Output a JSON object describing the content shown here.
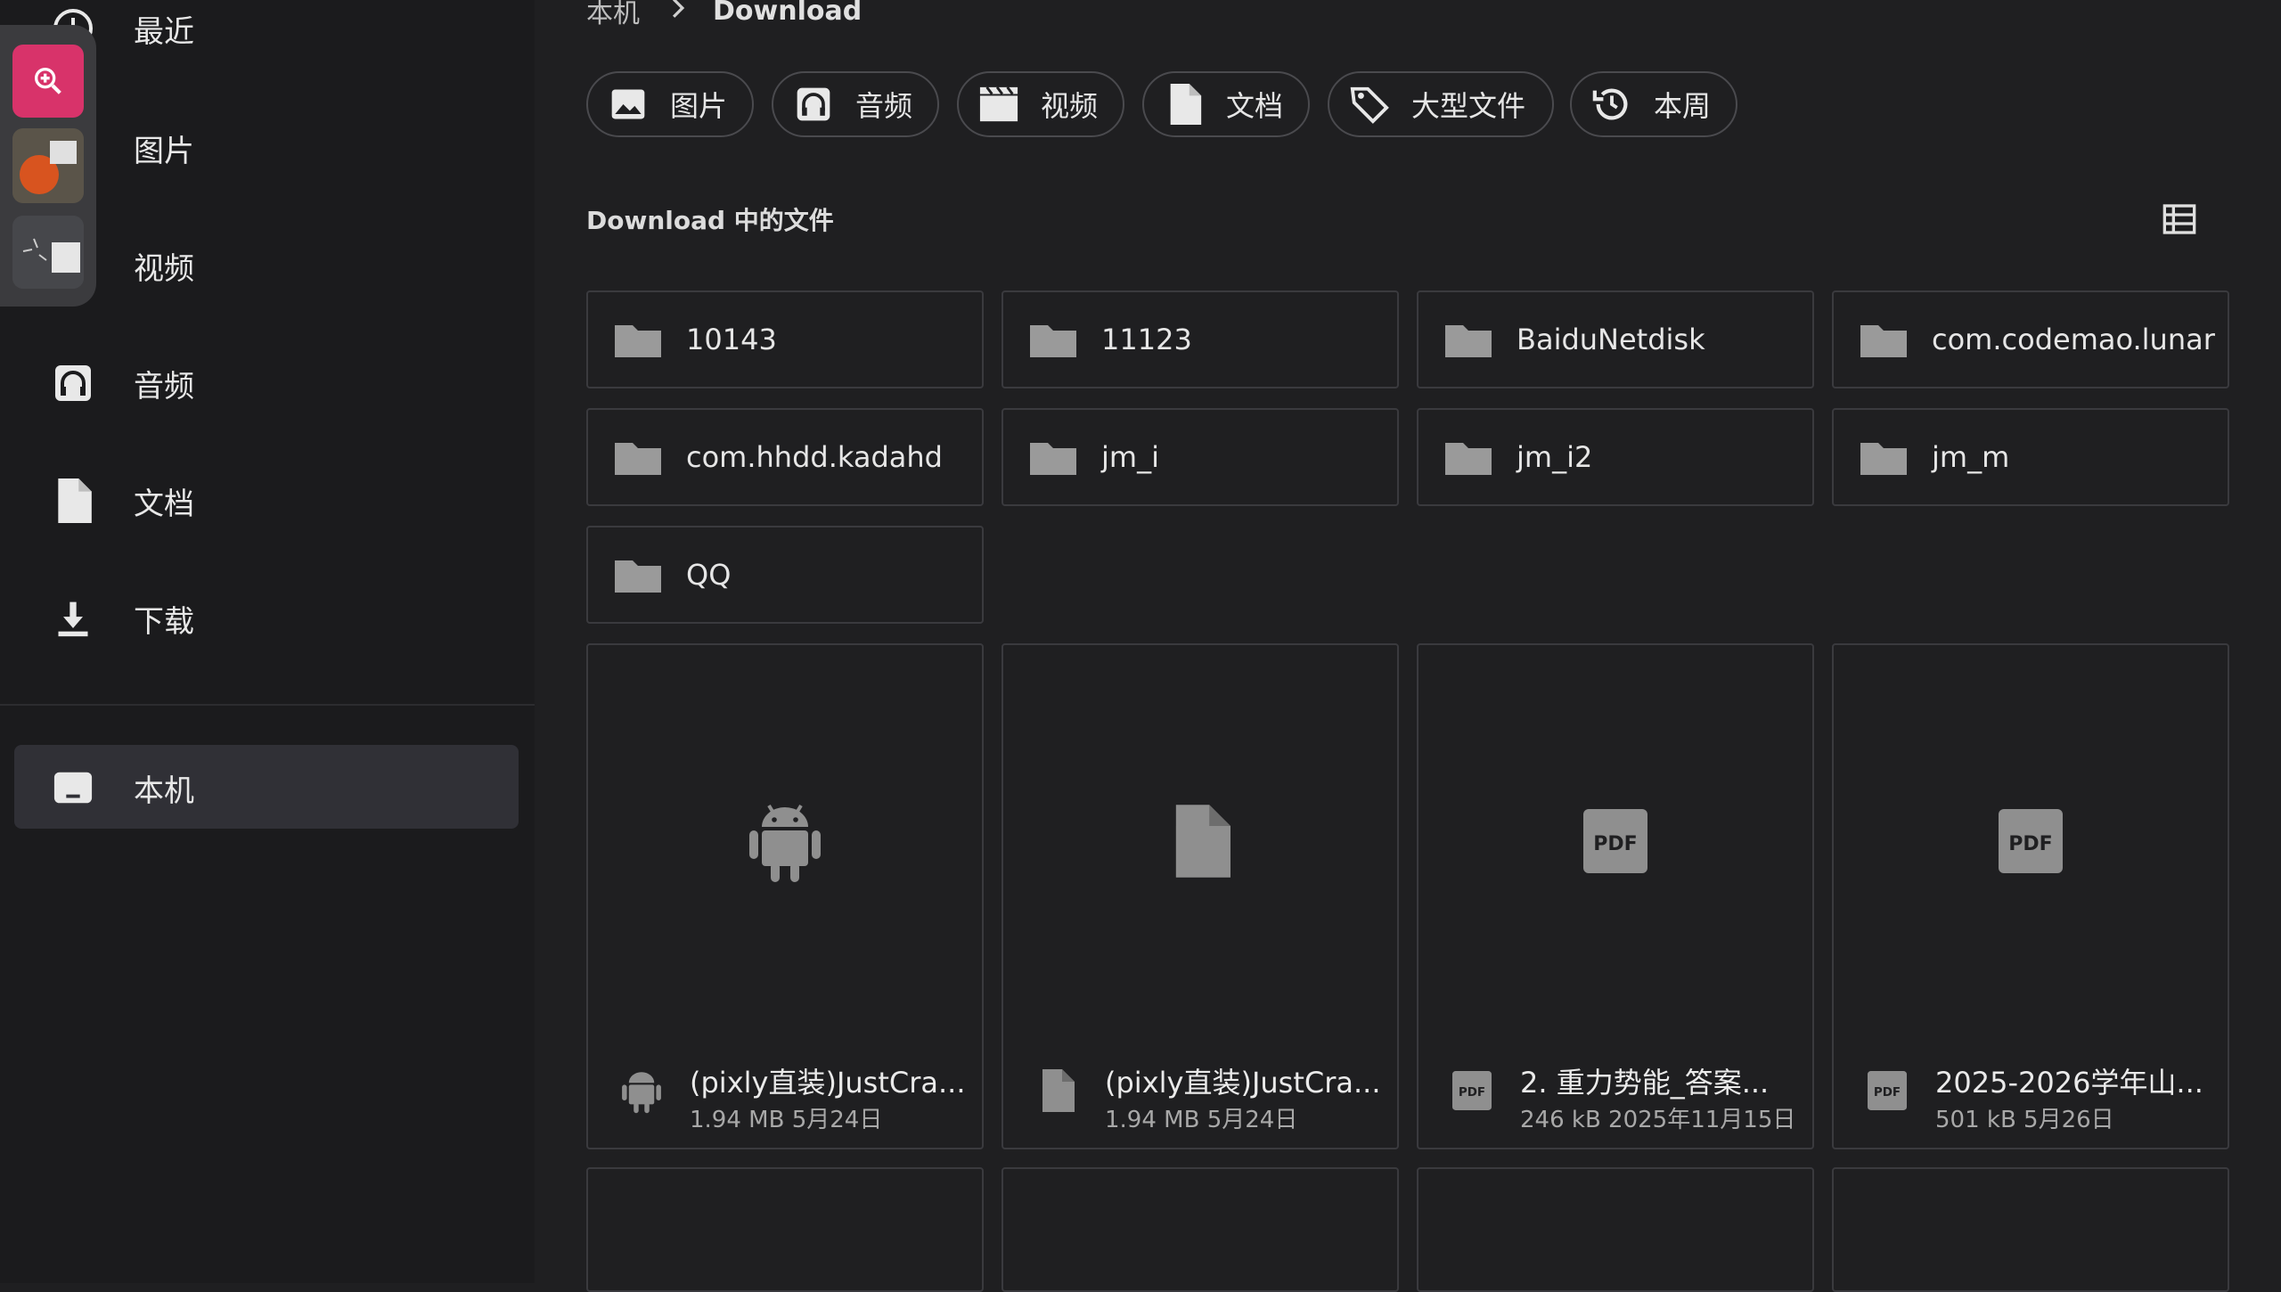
{
  "sidebar": {
    "items": [
      {
        "label": "最近",
        "icon": "clock-icon"
      },
      {
        "label": "图片",
        "icon": "image-icon"
      },
      {
        "label": "视频",
        "icon": "video-icon"
      },
      {
        "label": "音频",
        "icon": "headphones-icon"
      },
      {
        "label": "文档",
        "icon": "document-icon"
      },
      {
        "label": "下载",
        "icon": "download-icon"
      }
    ],
    "device": {
      "label": "本机",
      "icon": "tablet-icon"
    }
  },
  "floating_toolbar": {
    "zoom_icon": "zoom-in-icon",
    "accent": "#d8336a"
  },
  "breadcrumb": {
    "root": "本机",
    "separator": ">",
    "current": "Download"
  },
  "filters": [
    {
      "label": "图片",
      "icon": "image-icon"
    },
    {
      "label": "音频",
      "icon": "headphones-icon"
    },
    {
      "label": "视频",
      "icon": "video-icon"
    },
    {
      "label": "文档",
      "icon": "document-icon"
    },
    {
      "label": "大型文件",
      "icon": "tag-icon"
    },
    {
      "label": "本周",
      "icon": "history-icon"
    }
  ],
  "section": {
    "title": "Download 中的文件",
    "view_icon": "list-view-icon"
  },
  "folders": [
    {
      "name": "10143"
    },
    {
      "name": "11123"
    },
    {
      "name": "BaiduNetdisk"
    },
    {
      "name": "com.codemao.lunar"
    },
    {
      "name": "com.hhdd.kadahd"
    },
    {
      "name": "jm_i"
    },
    {
      "name": "jm_i2"
    },
    {
      "name": "jm_m"
    },
    {
      "name": "QQ"
    }
  ],
  "files": [
    {
      "name": "(pixly直装)JustCra...",
      "meta": "1.94 MB  5月24日",
      "type": "apk"
    },
    {
      "name": "(pixly直装)JustCra...",
      "meta": "1.94 MB  5月24日",
      "type": "file"
    },
    {
      "name": "2. 重力势能_答案...",
      "meta": "246 kB  2025年11月15日",
      "type": "pdf"
    },
    {
      "name": "2025-2026学年山...",
      "meta": "501 kB  5月26日",
      "type": "pdf"
    }
  ],
  "pdf_badge": "PDF",
  "colors": {
    "background": "#1f1f21",
    "sidebar": "#1b1b1d",
    "selected": "#303036",
    "border": "#3a3a3e"
  }
}
